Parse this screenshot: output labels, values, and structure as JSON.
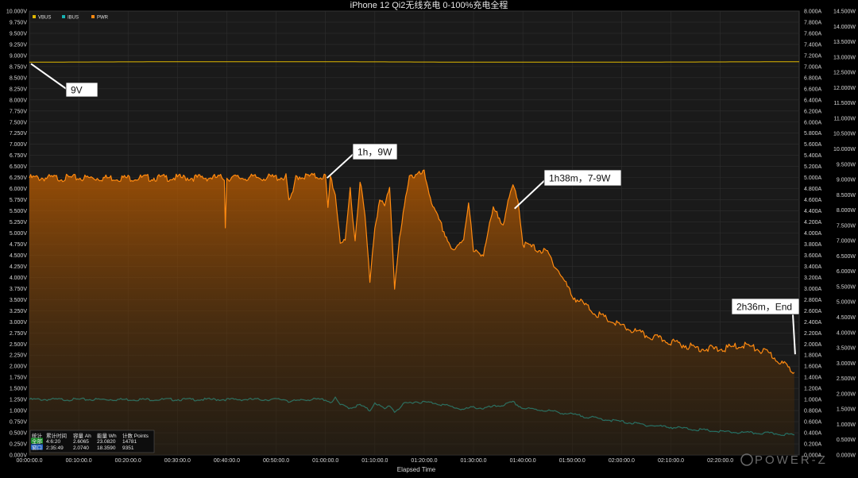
{
  "chart_data": {
    "type": "line",
    "title": "iPhone 12 Qi2无线充电 0-100%充电全程",
    "xlabel": "Elapsed Time",
    "x_ticks": [
      "00:00:00.0",
      "00:10:00.0",
      "00:20:00.0",
      "00:30:00.0",
      "00:40:00.0",
      "00:50:00.0",
      "01:00:00.0",
      "01:10:00.0",
      "01:20:00.0",
      "01:30:00.0",
      "01:40:00.0",
      "01:50:00.0",
      "02:00:00.0",
      "02:10:00.0",
      "02:20:00.0"
    ],
    "xlim_minutes": [
      0,
      156
    ],
    "y_left": {
      "unit": "V",
      "range": [
        0,
        10
      ],
      "ticks": [
        "0.000V",
        "0.250V",
        "0.500V",
        "0.750V",
        "1.000V",
        "1.250V",
        "1.500V",
        "1.750V",
        "2.000V",
        "2.250V",
        "2.500V",
        "2.750V",
        "3.000V",
        "3.250V",
        "3.500V",
        "3.750V",
        "4.000V",
        "4.250V",
        "4.500V",
        "4.750V",
        "5.000V",
        "5.250V",
        "5.500V",
        "5.750V",
        "6.000V",
        "6.250V",
        "6.500V",
        "6.750V",
        "7.000V",
        "7.250V",
        "7.500V",
        "7.750V",
        "8.000V",
        "8.250V",
        "8.500V",
        "8.750V",
        "9.000V",
        "9.250V",
        "9.500V",
        "9.750V",
        "10.000V"
      ]
    },
    "y_mid": {
      "unit": "A",
      "range": [
        0,
        8
      ],
      "ticks": [
        "0.000A",
        "0.200A",
        "0.400A",
        "0.600A",
        "0.800A",
        "1.000A",
        "1.200A",
        "1.400A",
        "1.600A",
        "1.800A",
        "2.000A",
        "2.200A",
        "2.400A",
        "2.600A",
        "2.800A",
        "3.000A",
        "3.200A",
        "3.400A",
        "3.600A",
        "3.800A",
        "4.000A",
        "4.200A",
        "4.400A",
        "4.600A",
        "4.800A",
        "5.000A",
        "5.200A",
        "5.400A",
        "5.600A",
        "5.800A",
        "6.000A",
        "6.200A",
        "6.400A",
        "6.600A",
        "6.800A",
        "7.000A",
        "7.200A",
        "7.400A",
        "7.600A",
        "7.800A",
        "8.000A"
      ]
    },
    "y_right": {
      "unit": "W",
      "range": [
        0,
        14.5
      ],
      "ticks": [
        "0.000W",
        "0.500W",
        "1.000W",
        "1.500W",
        "2.000W",
        "2.500W",
        "3.000W",
        "3.500W",
        "4.000W",
        "4.500W",
        "5.000W",
        "5.500W",
        "6.000W",
        "6.500W",
        "7.000W",
        "7.500W",
        "8.000W",
        "8.500W",
        "9.000W",
        "9.500W",
        "10.000W",
        "10.500W",
        "11.000W",
        "11.500W",
        "12.000W",
        "12.500W",
        "13.000W",
        "13.500W",
        "14.000W",
        "14.500W"
      ]
    },
    "legend_position": "top-left",
    "grid": true,
    "series": [
      {
        "name": "VBUS",
        "axis": "V",
        "color": "#e0b800",
        "points": [
          [
            0,
            8.85
          ],
          [
            30,
            8.86
          ],
          [
            60,
            8.86
          ],
          [
            90,
            8.85
          ],
          [
            120,
            8.85
          ],
          [
            156,
            8.86
          ]
        ]
      },
      {
        "name": "IBUS",
        "axis": "A",
        "color": "#16b2b2",
        "points": [
          [
            0,
            1.0
          ],
          [
            20,
            1.0
          ],
          [
            40,
            1.0
          ],
          [
            52,
            1.0
          ],
          [
            52.5,
            0.97
          ],
          [
            54.5,
            0.97
          ],
          [
            55,
            1.0
          ],
          [
            60,
            1.0
          ],
          [
            61,
            0.95
          ],
          [
            62,
            1.02
          ],
          [
            63,
            0.9
          ],
          [
            65,
            0.85
          ],
          [
            67,
            0.9
          ],
          [
            69,
            0.8
          ],
          [
            70,
            0.95
          ],
          [
            72,
            0.82
          ],
          [
            73,
            0.9
          ],
          [
            74,
            0.78
          ],
          [
            76,
            0.92
          ],
          [
            78,
            0.96
          ],
          [
            80,
            0.95
          ],
          [
            82,
            0.94
          ],
          [
            84,
            0.9
          ],
          [
            86,
            0.86
          ],
          [
            88,
            0.82
          ],
          [
            90,
            0.86
          ],
          [
            92,
            0.84
          ],
          [
            94,
            0.87
          ],
          [
            96,
            0.9
          ],
          [
            98,
            0.95
          ],
          [
            100,
            0.84
          ],
          [
            105,
            0.8
          ],
          [
            110,
            0.73
          ],
          [
            115,
            0.66
          ],
          [
            120,
            0.6
          ],
          [
            125,
            0.54
          ],
          [
            130,
            0.5
          ],
          [
            135,
            0.46
          ],
          [
            140,
            0.42
          ],
          [
            145,
            0.4
          ],
          [
            150,
            0.39
          ],
          [
            155,
            0.36
          ]
        ]
      },
      {
        "name": "PWR",
        "axis": "W",
        "color": "#ff8a10",
        "points": [
          [
            0,
            9.05
          ],
          [
            20,
            9.05
          ],
          [
            39.5,
            9.06
          ],
          [
            39.7,
            7.5
          ],
          [
            40,
            9.05
          ],
          [
            52,
            9.07
          ],
          [
            52.6,
            8.3
          ],
          [
            53.4,
            8.5
          ],
          [
            54,
            9.1
          ],
          [
            60,
            9.1
          ],
          [
            60.5,
            8.0
          ],
          [
            61,
            9.1
          ],
          [
            62,
            8.5
          ],
          [
            63,
            7.0
          ],
          [
            64,
            6.9
          ],
          [
            65,
            8.7
          ],
          [
            66,
            7.0
          ],
          [
            67,
            9.0
          ],
          [
            68,
            7.8
          ],
          [
            69,
            5.7
          ],
          [
            70,
            7.5
          ],
          [
            71,
            8.3
          ],
          [
            72,
            8.1
          ],
          [
            73,
            8.8
          ],
          [
            74,
            5.5
          ],
          [
            75,
            7.0
          ],
          [
            77,
            9.2
          ],
          [
            78,
            9.1
          ],
          [
            80,
            9.2
          ],
          [
            81,
            8.6
          ],
          [
            82,
            8.0
          ],
          [
            84,
            7.3
          ],
          [
            86,
            6.6
          ],
          [
            88,
            7.1
          ],
          [
            89,
            8.3
          ],
          [
            90,
            6.6
          ],
          [
            92,
            6.6
          ],
          [
            94,
            8.0
          ],
          [
            96,
            7.6
          ],
          [
            97,
            8.2
          ],
          [
            98,
            8.8
          ],
          [
            99,
            8.4
          ],
          [
            100,
            6.9
          ],
          [
            105,
            6.6
          ],
          [
            108,
            5.8
          ],
          [
            110,
            5.2
          ],
          [
            115,
            4.6
          ],
          [
            120,
            4.2
          ],
          [
            125,
            3.9
          ],
          [
            130,
            3.7
          ],
          [
            135,
            3.5
          ],
          [
            140,
            3.45
          ],
          [
            145,
            3.6
          ],
          [
            150,
            3.3
          ],
          [
            155,
            2.7
          ]
        ]
      }
    ],
    "annotations": [
      {
        "text": "9V",
        "at": [
          0,
          8.85
        ]
      },
      {
        "text": "1h，9W",
        "at": [
          60,
          9.1
        ]
      },
      {
        "text": "1h38m，7-9W",
        "at": [
          98,
          8.1
        ]
      },
      {
        "text": "2h36m，End",
        "at": [
          155.5,
          3.6
        ]
      }
    ],
    "stats_table": {
      "headers": [
        "统计",
        "累计时间",
        "容量 Ah",
        "能量 Wh",
        "计数 Points"
      ],
      "rows": [
        [
          "全部",
          "4:6:20",
          "2.6065",
          "23.0820",
          "14781"
        ],
        [
          "窗口",
          "2:35:49",
          "2.0740",
          "18.3590",
          "9351"
        ]
      ]
    }
  },
  "watermark": "POWER-Z"
}
